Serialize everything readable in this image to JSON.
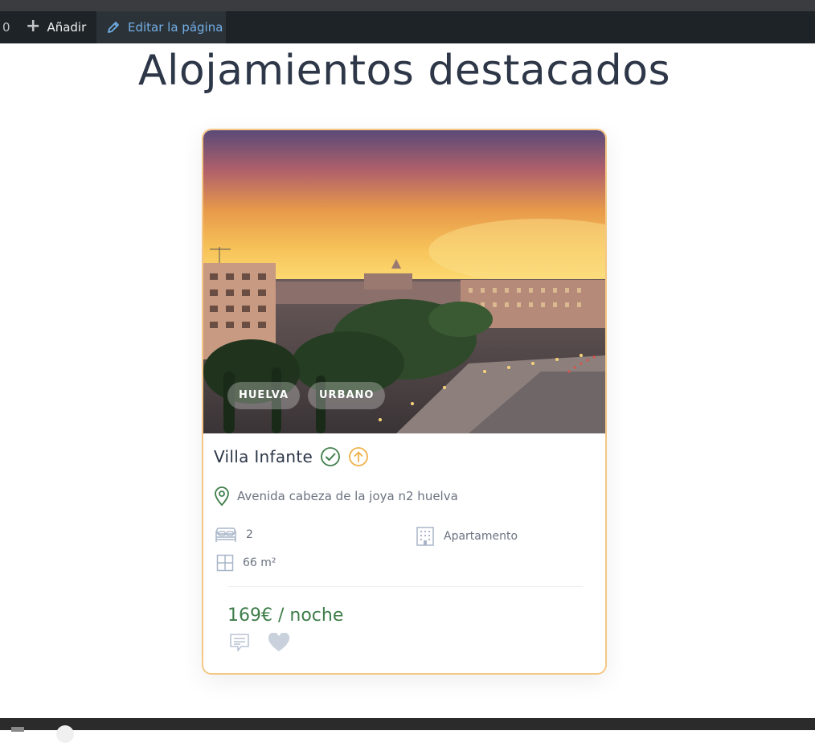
{
  "admin_bar": {
    "counter": "0",
    "add_label": "Añadir",
    "edit_label": "Editar la página"
  },
  "page": {
    "title": "Alojamientos destacados"
  },
  "card": {
    "name": "Villa Infante",
    "tags": [
      "HUELVA",
      "URBANO"
    ],
    "address": "Avenida cabeza de la joya n2 huelva",
    "bedrooms": "2",
    "type": "Apartamento",
    "area": "66 m²",
    "price": "169€ / noche",
    "icons": {
      "verified": "check-circle-icon",
      "featured": "arrow-up-circle-icon",
      "location": "map-pin-icon",
      "bed": "bed-icon",
      "building": "building-icon",
      "area": "floorplan-icon",
      "comment": "comment-icon",
      "favorite": "heart-icon"
    }
  },
  "colors": {
    "accent_green": "#3f7d4a",
    "card_border": "#f4c784",
    "featured_orange": "#f0b04a",
    "admin_bg": "#1d2327",
    "admin_link": "#72aee6"
  }
}
